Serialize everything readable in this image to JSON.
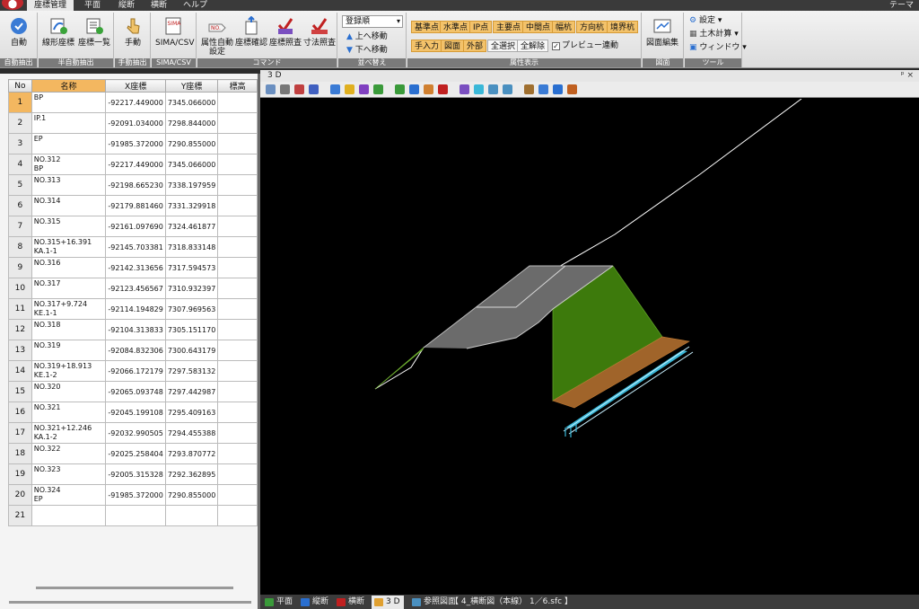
{
  "menu": {
    "tabs": [
      "座標管理",
      "平面",
      "縦断",
      "横断",
      "ヘルプ"
    ],
    "active": "座標管理",
    "theme": "テーマ"
  },
  "ribbon": {
    "auto": {
      "btn": "自動",
      "group": "自動抽出"
    },
    "semi": {
      "btn1": "線形座標",
      "btn2": "座標一覧",
      "group": "半自動抽出"
    },
    "manual": {
      "btn": "手動",
      "group": "手動抽出"
    },
    "sima": {
      "btn": "SIMA/CSV",
      "group": "SIMA/CSV"
    },
    "command": {
      "btn1": "属性自動設定",
      "btn2": "座標確認",
      "btn3": "座標照査",
      "btn4": "寸法照査",
      "group": "コマンド"
    },
    "sort": {
      "combo": "登録順",
      "up": "上へ移動",
      "down": "下へ移動",
      "group": "並べ替え"
    },
    "attr": {
      "row1": [
        "基準点",
        "水準点",
        "IP点",
        "主要点",
        "中間点",
        "幅杭",
        "方向杭",
        "境界杭"
      ],
      "row2": [
        "手入力",
        "図面",
        "外部"
      ],
      "select_all": "全選択",
      "deselect_all": "全解除",
      "preview": "プレビュー連動",
      "group": "属性表示"
    },
    "drawing": {
      "btn": "図面編集",
      "group": "図面"
    },
    "tools": {
      "settings": "設定",
      "civil": "土木計算",
      "window": "ウィンドウ",
      "group": "ツール"
    }
  },
  "table": {
    "headers": [
      "No",
      "名称",
      "X座標",
      "Y座標",
      "標高"
    ],
    "rows": [
      {
        "no": "1",
        "n1": "BP",
        "n2": "",
        "x": "-92217.449000",
        "y": "7345.066000",
        "z": ""
      },
      {
        "no": "2",
        "n1": "IP.1",
        "n2": "",
        "x": "-92091.034000",
        "y": "7298.844000",
        "z": ""
      },
      {
        "no": "3",
        "n1": "EP",
        "n2": "",
        "x": "-91985.372000",
        "y": "7290.855000",
        "z": ""
      },
      {
        "no": "4",
        "n1": "NO.312",
        "n2": "BP",
        "x": "-92217.449000",
        "y": "7345.066000",
        "z": ""
      },
      {
        "no": "5",
        "n1": "NO.313",
        "n2": "",
        "x": "-92198.665230",
        "y": "7338.197959",
        "z": ""
      },
      {
        "no": "6",
        "n1": "NO.314",
        "n2": "",
        "x": "-92179.881460",
        "y": "7331.329918",
        "z": ""
      },
      {
        "no": "7",
        "n1": "NO.315",
        "n2": "",
        "x": "-92161.097690",
        "y": "7324.461877",
        "z": ""
      },
      {
        "no": "8",
        "n1": "NO.315+16.391",
        "n2": "KA.1-1",
        "x": "-92145.703381",
        "y": "7318.833148",
        "z": ""
      },
      {
        "no": "9",
        "n1": "NO.316",
        "n2": "",
        "x": "-92142.313656",
        "y": "7317.594573",
        "z": ""
      },
      {
        "no": "10",
        "n1": "NO.317",
        "n2": "",
        "x": "-92123.456567",
        "y": "7310.932397",
        "z": ""
      },
      {
        "no": "11",
        "n1": "NO.317+9.724",
        "n2": "KE.1-1",
        "x": "-92114.194829",
        "y": "7307.969563",
        "z": ""
      },
      {
        "no": "12",
        "n1": "NO.318",
        "n2": "",
        "x": "-92104.313833",
        "y": "7305.151170",
        "z": ""
      },
      {
        "no": "13",
        "n1": "NO.319",
        "n2": "",
        "x": "-92084.832306",
        "y": "7300.643179",
        "z": ""
      },
      {
        "no": "14",
        "n1": "NO.319+18.913",
        "n2": "KE.1-2",
        "x": "-92066.172179",
        "y": "7297.583132",
        "z": ""
      },
      {
        "no": "15",
        "n1": "NO.320",
        "n2": "",
        "x": "-92065.093748",
        "y": "7297.442987",
        "z": ""
      },
      {
        "no": "16",
        "n1": "NO.321",
        "n2": "",
        "x": "-92045.199108",
        "y": "7295.409163",
        "z": ""
      },
      {
        "no": "17",
        "n1": "NO.321+12.246",
        "n2": "KA.1-2",
        "x": "-92032.990505",
        "y": "7294.455388",
        "z": ""
      },
      {
        "no": "18",
        "n1": "NO.322",
        "n2": "",
        "x": "-92025.258404",
        "y": "7293.870772",
        "z": ""
      },
      {
        "no": "19",
        "n1": "NO.323",
        "n2": "",
        "x": "-92005.315328",
        "y": "7292.362895",
        "z": ""
      },
      {
        "no": "20",
        "n1": "NO.324",
        "n2": "EP",
        "x": "-91985.372000",
        "y": "7290.855000",
        "z": ""
      },
      {
        "no": "21",
        "n1": "",
        "n2": "",
        "x": "",
        "y": "",
        "z": ""
      }
    ]
  },
  "view": {
    "title": "3 D",
    "controls": "ᵖ ×"
  },
  "bottom_tabs": [
    "平面",
    "縦断",
    "横断",
    "3 D",
    "参照図面",
    "【 4_横断図（本線） 1／6.sfc 】"
  ],
  "colors": {
    "accent_orange": "#f3b760",
    "road_surface": "#6b6b6b",
    "slope_green": "#3d7a0c",
    "soil_brown": "#a0642a",
    "drain_cyan": "#3ab8d8"
  }
}
